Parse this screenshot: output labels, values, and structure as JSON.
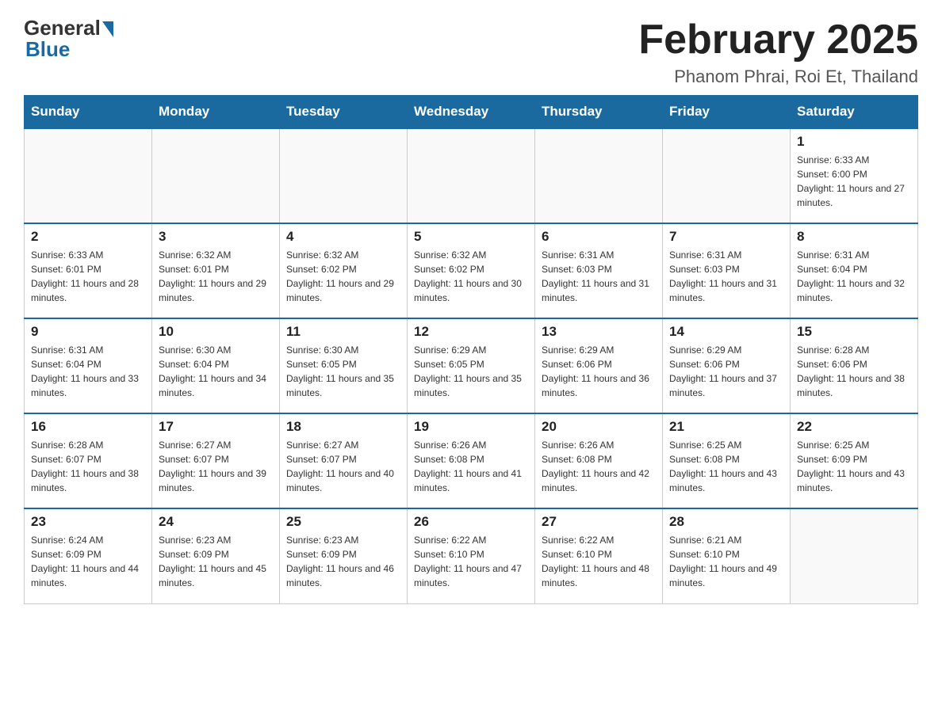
{
  "header": {
    "logo_general": "General",
    "logo_blue": "Blue",
    "month_title": "February 2025",
    "subtitle": "Phanom Phrai, Roi Et, Thailand"
  },
  "days_of_week": [
    "Sunday",
    "Monday",
    "Tuesday",
    "Wednesday",
    "Thursday",
    "Friday",
    "Saturday"
  ],
  "weeks": [
    [
      {
        "day": "",
        "info": ""
      },
      {
        "day": "",
        "info": ""
      },
      {
        "day": "",
        "info": ""
      },
      {
        "day": "",
        "info": ""
      },
      {
        "day": "",
        "info": ""
      },
      {
        "day": "",
        "info": ""
      },
      {
        "day": "1",
        "info": "Sunrise: 6:33 AM\nSunset: 6:00 PM\nDaylight: 11 hours and 27 minutes."
      }
    ],
    [
      {
        "day": "2",
        "info": "Sunrise: 6:33 AM\nSunset: 6:01 PM\nDaylight: 11 hours and 28 minutes."
      },
      {
        "day": "3",
        "info": "Sunrise: 6:32 AM\nSunset: 6:01 PM\nDaylight: 11 hours and 29 minutes."
      },
      {
        "day": "4",
        "info": "Sunrise: 6:32 AM\nSunset: 6:02 PM\nDaylight: 11 hours and 29 minutes."
      },
      {
        "day": "5",
        "info": "Sunrise: 6:32 AM\nSunset: 6:02 PM\nDaylight: 11 hours and 30 minutes."
      },
      {
        "day": "6",
        "info": "Sunrise: 6:31 AM\nSunset: 6:03 PM\nDaylight: 11 hours and 31 minutes."
      },
      {
        "day": "7",
        "info": "Sunrise: 6:31 AM\nSunset: 6:03 PM\nDaylight: 11 hours and 31 minutes."
      },
      {
        "day": "8",
        "info": "Sunrise: 6:31 AM\nSunset: 6:04 PM\nDaylight: 11 hours and 32 minutes."
      }
    ],
    [
      {
        "day": "9",
        "info": "Sunrise: 6:31 AM\nSunset: 6:04 PM\nDaylight: 11 hours and 33 minutes."
      },
      {
        "day": "10",
        "info": "Sunrise: 6:30 AM\nSunset: 6:04 PM\nDaylight: 11 hours and 34 minutes."
      },
      {
        "day": "11",
        "info": "Sunrise: 6:30 AM\nSunset: 6:05 PM\nDaylight: 11 hours and 35 minutes."
      },
      {
        "day": "12",
        "info": "Sunrise: 6:29 AM\nSunset: 6:05 PM\nDaylight: 11 hours and 35 minutes."
      },
      {
        "day": "13",
        "info": "Sunrise: 6:29 AM\nSunset: 6:06 PM\nDaylight: 11 hours and 36 minutes."
      },
      {
        "day": "14",
        "info": "Sunrise: 6:29 AM\nSunset: 6:06 PM\nDaylight: 11 hours and 37 minutes."
      },
      {
        "day": "15",
        "info": "Sunrise: 6:28 AM\nSunset: 6:06 PM\nDaylight: 11 hours and 38 minutes."
      }
    ],
    [
      {
        "day": "16",
        "info": "Sunrise: 6:28 AM\nSunset: 6:07 PM\nDaylight: 11 hours and 38 minutes."
      },
      {
        "day": "17",
        "info": "Sunrise: 6:27 AM\nSunset: 6:07 PM\nDaylight: 11 hours and 39 minutes."
      },
      {
        "day": "18",
        "info": "Sunrise: 6:27 AM\nSunset: 6:07 PM\nDaylight: 11 hours and 40 minutes."
      },
      {
        "day": "19",
        "info": "Sunrise: 6:26 AM\nSunset: 6:08 PM\nDaylight: 11 hours and 41 minutes."
      },
      {
        "day": "20",
        "info": "Sunrise: 6:26 AM\nSunset: 6:08 PM\nDaylight: 11 hours and 42 minutes."
      },
      {
        "day": "21",
        "info": "Sunrise: 6:25 AM\nSunset: 6:08 PM\nDaylight: 11 hours and 43 minutes."
      },
      {
        "day": "22",
        "info": "Sunrise: 6:25 AM\nSunset: 6:09 PM\nDaylight: 11 hours and 43 minutes."
      }
    ],
    [
      {
        "day": "23",
        "info": "Sunrise: 6:24 AM\nSunset: 6:09 PM\nDaylight: 11 hours and 44 minutes."
      },
      {
        "day": "24",
        "info": "Sunrise: 6:23 AM\nSunset: 6:09 PM\nDaylight: 11 hours and 45 minutes."
      },
      {
        "day": "25",
        "info": "Sunrise: 6:23 AM\nSunset: 6:09 PM\nDaylight: 11 hours and 46 minutes."
      },
      {
        "day": "26",
        "info": "Sunrise: 6:22 AM\nSunset: 6:10 PM\nDaylight: 11 hours and 47 minutes."
      },
      {
        "day": "27",
        "info": "Sunrise: 6:22 AM\nSunset: 6:10 PM\nDaylight: 11 hours and 48 minutes."
      },
      {
        "day": "28",
        "info": "Sunrise: 6:21 AM\nSunset: 6:10 PM\nDaylight: 11 hours and 49 minutes."
      },
      {
        "day": "",
        "info": ""
      }
    ]
  ]
}
